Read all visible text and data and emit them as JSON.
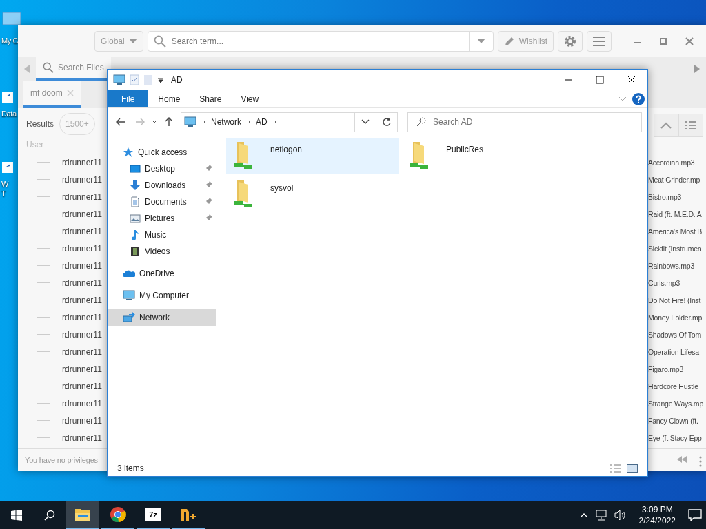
{
  "desktop_icons": [
    {
      "label": "My C",
      "kind": "computer"
    },
    {
      "label": "Data",
      "kind": "shortcut"
    },
    {
      "label": "W\nT",
      "kind": "shortcut"
    }
  ],
  "back_window": {
    "scope": "Global",
    "search_placeholder": "Search term...",
    "wishlist": "Wishlist",
    "tabs": [
      {
        "label": "Search Files",
        "selected": true
      }
    ],
    "search_tabs": [
      {
        "label": "mf doom",
        "selected": true
      }
    ],
    "results_label": "Results",
    "results_count": "1500+",
    "column_1": "User",
    "rows": [
      {
        "user": "rdrunner11",
        "file": "Accordian.mp3"
      },
      {
        "user": "rdrunner11",
        "file": "Meat Grinder.mp"
      },
      {
        "user": "rdrunner11",
        "file": "Bistro.mp3"
      },
      {
        "user": "rdrunner11",
        "file": "Raid (ft. M.E.D. A"
      },
      {
        "user": "rdrunner11",
        "file": "America's Most B"
      },
      {
        "user": "rdrunner11",
        "file": "Sickfit (Instrumen"
      },
      {
        "user": "rdrunner11",
        "file": "Rainbows.mp3"
      },
      {
        "user": "rdrunner11",
        "file": "Curls.mp3"
      },
      {
        "user": "rdrunner11",
        "file": "Do Not Fire! (Inst"
      },
      {
        "user": "rdrunner11",
        "file": "Money Folder.mp"
      },
      {
        "user": "rdrunner11",
        "file": "Shadows Of Tom"
      },
      {
        "user": "rdrunner11",
        "file": "Operation Lifesa"
      },
      {
        "user": "rdrunner11",
        "file": "Figaro.mp3"
      },
      {
        "user": "rdrunner11",
        "file": "Hardcore Hustle"
      },
      {
        "user": "rdrunner11",
        "file": "Strange Ways.mp"
      },
      {
        "user": "rdrunner11",
        "file": "Fancy Clown (ft."
      },
      {
        "user": "rdrunner11",
        "file": "Eye (ft Stacy Epp"
      }
    ],
    "status": "You have no privileges"
  },
  "explorer": {
    "title": "AD",
    "ribbon_tabs": [
      {
        "label": "File",
        "selected": true
      },
      {
        "label": "Home",
        "selected": false
      },
      {
        "label": "Share",
        "selected": false
      },
      {
        "label": "View",
        "selected": false
      }
    ],
    "breadcrumb": [
      "Network",
      "AD"
    ],
    "search_placeholder": "Search AD",
    "nav": [
      {
        "label": "Quick access",
        "kind": "star",
        "selected": false,
        "children": [
          {
            "label": "Desktop",
            "kind": "desktop",
            "pinned": true,
            "selected": false
          },
          {
            "label": "Downloads",
            "kind": "download",
            "pinned": true,
            "selected": false
          },
          {
            "label": "Documents",
            "kind": "document",
            "pinned": true,
            "selected": false
          },
          {
            "label": "Pictures",
            "kind": "picture",
            "pinned": true,
            "selected": false
          },
          {
            "label": "Music",
            "kind": "music",
            "pinned": false,
            "selected": false
          },
          {
            "label": "Videos",
            "kind": "video",
            "pinned": false,
            "selected": false
          }
        ]
      },
      {
        "label": "OneDrive",
        "kind": "cloud",
        "selected": false
      },
      {
        "label": "My Computer",
        "kind": "computer",
        "selected": false
      },
      {
        "label": "Network",
        "kind": "network",
        "selected": true
      }
    ],
    "items": [
      {
        "name": "netlogon",
        "selected": true
      },
      {
        "name": "PublicRes",
        "selected": false
      },
      {
        "name": "sysvol",
        "selected": false
      }
    ],
    "status": "3 items"
  },
  "taskbar": {
    "apps": [
      {
        "kind": "explorer",
        "active": true
      },
      {
        "kind": "chrome",
        "active": false
      },
      {
        "kind": "archiver",
        "label": "7z",
        "active": false
      },
      {
        "kind": "editor",
        "active": false
      }
    ],
    "time": "3:09 PM",
    "date": "2/24/2022"
  }
}
